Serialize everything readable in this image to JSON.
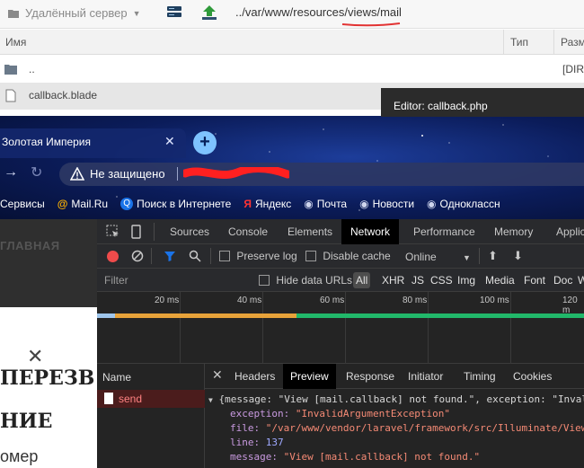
{
  "file_manager": {
    "server_label": "Удалённый сервер",
    "path": "../var/www/resources/views/mail",
    "columns": {
      "name": "Имя",
      "type": "Тип",
      "size": "Разм"
    },
    "rows": [
      {
        "name": "..",
        "type": "[DIR"
      },
      {
        "name": "callback.blade",
        "type": ""
      }
    ]
  },
  "editor": {
    "title": "Editor: callback.php"
  },
  "browser": {
    "tab_title": "Золотая Империя",
    "security_text": "Не защищено",
    "bookmarks": [
      "Сервисы",
      "Mail.Ru",
      "Поиск в Интернете",
      "Яндекс",
      "Почта",
      "Новости",
      "Одноклассн"
    ]
  },
  "page": {
    "nav_text": "ГЛАВНАЯ",
    "heading1": "ПЕРЕЗВ",
    "heading2": "НИЕ",
    "para": "омер"
  },
  "devtools": {
    "tabs": [
      "Sources",
      "Console",
      "Elements",
      "Network",
      "Performance",
      "Memory",
      "Applic"
    ],
    "active_tab": "Network",
    "preserve_log": "Preserve log",
    "disable_cache": "Disable cache",
    "throttle": "Online",
    "filter_placeholder": "Filter",
    "hide_data_urls": "Hide data URLs",
    "filter_types": [
      "All",
      "XHR",
      "JS",
      "CSS",
      "Img",
      "Media",
      "Font",
      "Doc",
      "W"
    ],
    "ticks": [
      "20 ms",
      "40 ms",
      "60 ms",
      "80 ms",
      "100 ms",
      "120 m"
    ],
    "name_header": "Name",
    "request_name": "send",
    "detail_tabs": [
      "Headers",
      "Preview",
      "Response",
      "Initiator",
      "Timing",
      "Cookies"
    ],
    "active_detail": "Preview",
    "preview": {
      "summary": "{message: \"View [mail.callback] not found.\", exception: \"Inval",
      "exception_key": "exception:",
      "exception_val": "\"InvalidArgumentException\"",
      "file_key": "file:",
      "file_val": "\"/var/www/vendor/laravel/framework/src/Illuminate/View",
      "line_key": "line:",
      "line_val": "137",
      "message_key": "message:",
      "message_val": "\"View [mail.callback] not found.\""
    }
  },
  "colors": {
    "devtools_bg": "#242424",
    "error_red": "#ff8383",
    "accent_blue": "#1a73e8",
    "waterfall_orange": "#e8a33a",
    "waterfall_green": "#21b86a"
  }
}
